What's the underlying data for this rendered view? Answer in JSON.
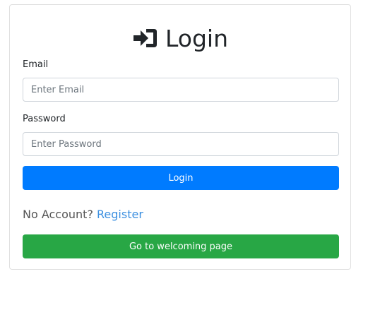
{
  "title": {
    "icon": "sign-in-icon",
    "text": "Login"
  },
  "form": {
    "email_label": "Email",
    "email_placeholder": "Enter Email",
    "email_value": "",
    "password_label": "Password",
    "password_placeholder": "Enter Password",
    "password_value": "",
    "submit_label": "Login"
  },
  "register": {
    "prompt": "No Account?",
    "link_label": "Register"
  },
  "welcome_button_label": "Go to welcoming page",
  "colors": {
    "primary": "#007bff",
    "success": "#28a745",
    "link": "#3b8fe0"
  }
}
